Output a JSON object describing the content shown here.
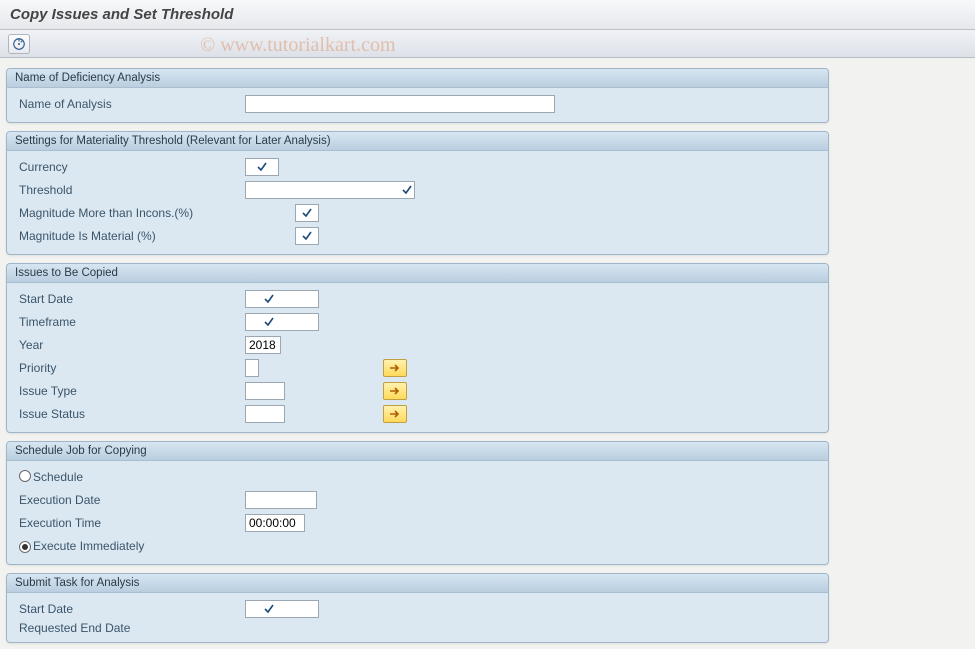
{
  "title": "Copy Issues and Set Threshold",
  "watermark": "© www.tutorialkart.com",
  "groups": {
    "g1": {
      "title": "Name of Deficiency Analysis",
      "name_of_analysis_label": "Name of Analysis",
      "name_of_analysis_value": ""
    },
    "g2": {
      "title": "Settings for Materiality Threshold (Relevant for Later Analysis)",
      "currency_label": "Currency",
      "currency_value": "",
      "threshold_label": "Threshold",
      "threshold_value": "",
      "mag_more_label": "Magnitude More than Incons.(%)",
      "mag_more_value": "",
      "mag_material_label": "Magnitude Is Material (%)",
      "mag_material_value": ""
    },
    "g3": {
      "title": "Issues to Be Copied",
      "start_date_label": "Start Date",
      "start_date_value": "",
      "timeframe_label": "Timeframe",
      "timeframe_value": "",
      "year_label": "Year",
      "year_value": "2018",
      "priority_label": "Priority",
      "priority_value": "",
      "issue_type_label": "Issue Type",
      "issue_type_value": "",
      "issue_status_label": "Issue Status",
      "issue_status_value": ""
    },
    "g4": {
      "title": "Schedule Job for Copying",
      "schedule_label": "Schedule",
      "exec_date_label": "Execution Date",
      "exec_date_value": "",
      "exec_time_label": "Execution Time",
      "exec_time_value": "00:00:00",
      "exec_now_label": "Execute Immediately"
    },
    "g5": {
      "title": "Submit Task for Analysis",
      "start_date_label": "Start Date",
      "start_date_value": "",
      "req_end_label": "Requested End Date"
    }
  }
}
